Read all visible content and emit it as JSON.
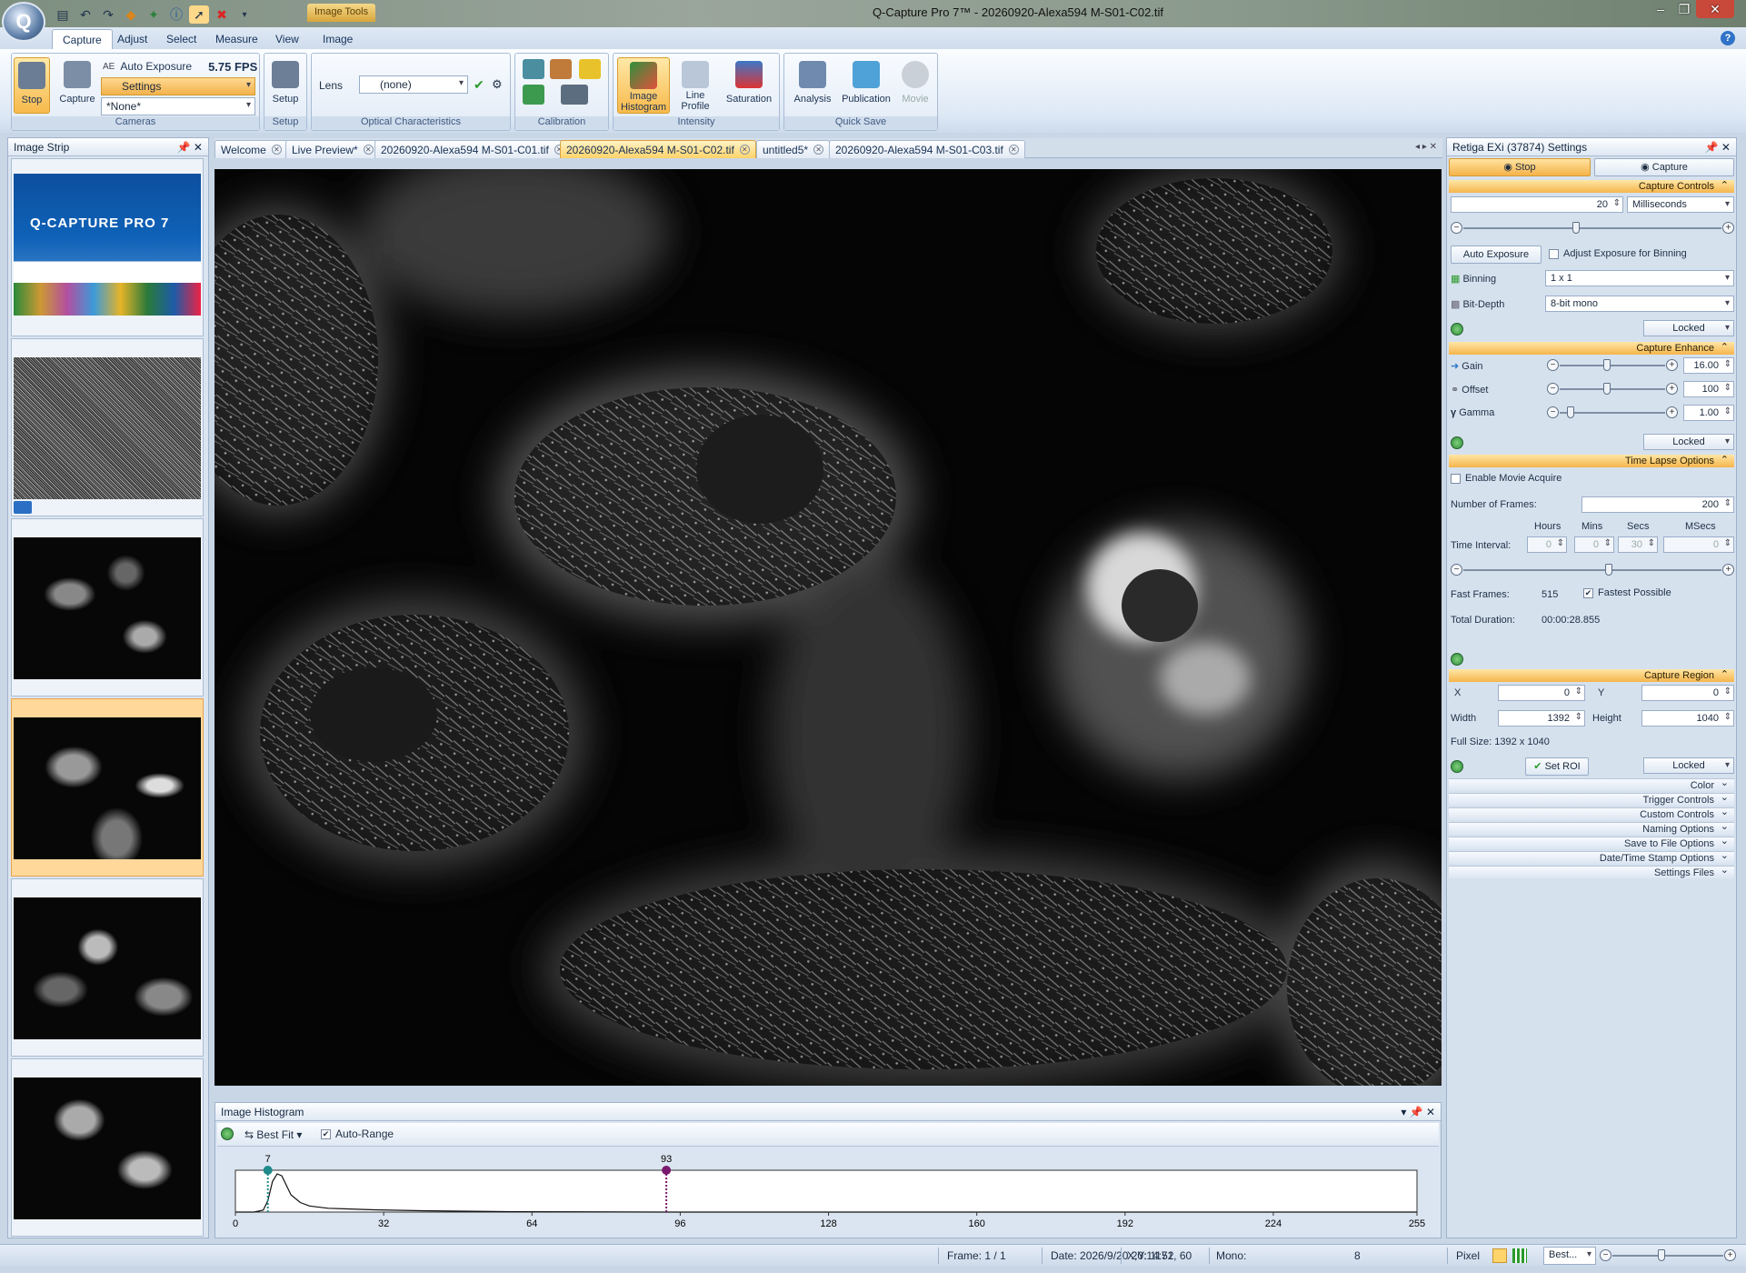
{
  "window": {
    "title": "Q-Capture Pro 7™ - 20260920-Alexa594 M-S01-C02.tif",
    "contextual_tab": "Image Tools",
    "app_icon": "Q"
  },
  "ribbon_tabs": [
    "Capture",
    "Adjust",
    "Select",
    "Measure",
    "View",
    "Image"
  ],
  "ribbon": {
    "stop_label": "Stop",
    "capture_label": "Capture",
    "auto_exposure_label": "Auto Exposure",
    "fps": "5.75 FPS",
    "settings_combo": "Settings",
    "none_combo": "*None*",
    "cameras_group": "Cameras",
    "setup_label": "Setup",
    "setup_group": "Setup",
    "lens_label": "Lens",
    "lens_combo": "(none)",
    "optical_group": "Optical Characteristics",
    "calibration_group": "Calibration",
    "image_histogram_label": "Image Histogram",
    "line_profile_label": "Line Profile",
    "saturation_label": "Saturation",
    "intensity_group": "Intensity",
    "analysis_label": "Analysis",
    "publication_label": "Publication",
    "movie_label": "Movie",
    "quicksave_group": "Quick Save"
  },
  "image_strip": {
    "title": "Image Strip",
    "splash_title": "Q-CAPTURE PRO 7"
  },
  "doc_tabs": [
    "Welcome",
    "Live Preview*",
    "20260920-Alexa594 M-S01-C01.tif",
    "20260920-Alexa594 M-S01-C02.tif",
    "untitled5*",
    "20260920-Alexa594 M-S01-C03.tif"
  ],
  "settings": {
    "title": "Retiga EXi (37874) Settings",
    "stop_tab": "Stop",
    "capture_tab": "Capture",
    "capture_controls": "Capture Controls",
    "exposure_value": "20",
    "exposure_unit": "Milliseconds",
    "auto_exposure_btn": "Auto Exposure",
    "adjust_binning": "Adjust Exposure for Binning",
    "binning_label": "Binning",
    "binning_value": "1 x 1",
    "bitdepth_label": "Bit-Depth",
    "bitdepth_value": "8-bit mono",
    "locked": "Locked",
    "capture_enhance": "Capture Enhance",
    "gain_label": "Gain",
    "gain_value": "16.00",
    "offset_label": "Offset",
    "offset_value": "100",
    "gamma_label": "Gamma",
    "gamma_value": "1.00",
    "time_lapse": "Time Lapse Options",
    "enable_movie": "Enable Movie Acquire",
    "num_frames_label": "Number of Frames:",
    "num_frames_value": "200",
    "hours": "Hours",
    "mins": "Mins",
    "secs": "Secs",
    "msecs": "MSecs",
    "time_interval": "Time Interval:",
    "ti_hours": "0",
    "ti_mins": "0",
    "ti_secs": "30",
    "ti_msecs": "0",
    "fast_frames_label": "Fast Frames:",
    "fast_frames_value": "515",
    "fastest_possible": "Fastest Possible",
    "total_duration_label": "Total Duration:",
    "total_duration_value": "00:00:28.855",
    "capture_region": "Capture Region",
    "x_label": "X",
    "x_value": "0",
    "y_label": "Y",
    "y_value": "0",
    "width_label": "Width",
    "width_value": "1392",
    "height_label": "Height",
    "height_value": "1040",
    "full_size": "Full Size: 1392 x 1040",
    "set_roi": "Set ROI",
    "collapsed_sections": [
      "Color",
      "Trigger Controls",
      "Custom Controls",
      "Naming Options",
      "Save to File Options",
      "Date/Time Stamp Options",
      "Settings Files"
    ]
  },
  "histogram": {
    "title": "Image Histogram",
    "best_fit": "Best Fit",
    "auto_range": "Auto-Range",
    "low_marker": "7",
    "high_marker": "93",
    "ticks": [
      "0",
      "32",
      "64",
      "96",
      "128",
      "160",
      "192",
      "224",
      "255"
    ]
  },
  "chart_data": {
    "type": "area",
    "x": [
      0,
      4,
      6,
      7,
      8,
      9,
      10,
      11,
      12,
      14,
      16,
      20,
      30,
      40,
      60,
      93,
      128,
      255
    ],
    "y": [
      0,
      0,
      0.05,
      0.3,
      0.8,
      1.0,
      0.95,
      0.7,
      0.45,
      0.25,
      0.16,
      0.1,
      0.06,
      0.035,
      0.01,
      0.0,
      0.0,
      0.0
    ],
    "xlim": [
      0,
      255
    ],
    "markers": [
      7,
      93
    ],
    "marker_colors": [
      "#1f8a8a",
      "#7a1a6e"
    ]
  },
  "statusbar": {
    "frame": "Frame: 1 / 1",
    "date": "Date: 2026/9/20 20:14:52",
    "xy": "X,Y: 1171,   60",
    "mono": "Mono:",
    "mono_value": "8",
    "pixel": "Pixel",
    "best": "Best..."
  }
}
